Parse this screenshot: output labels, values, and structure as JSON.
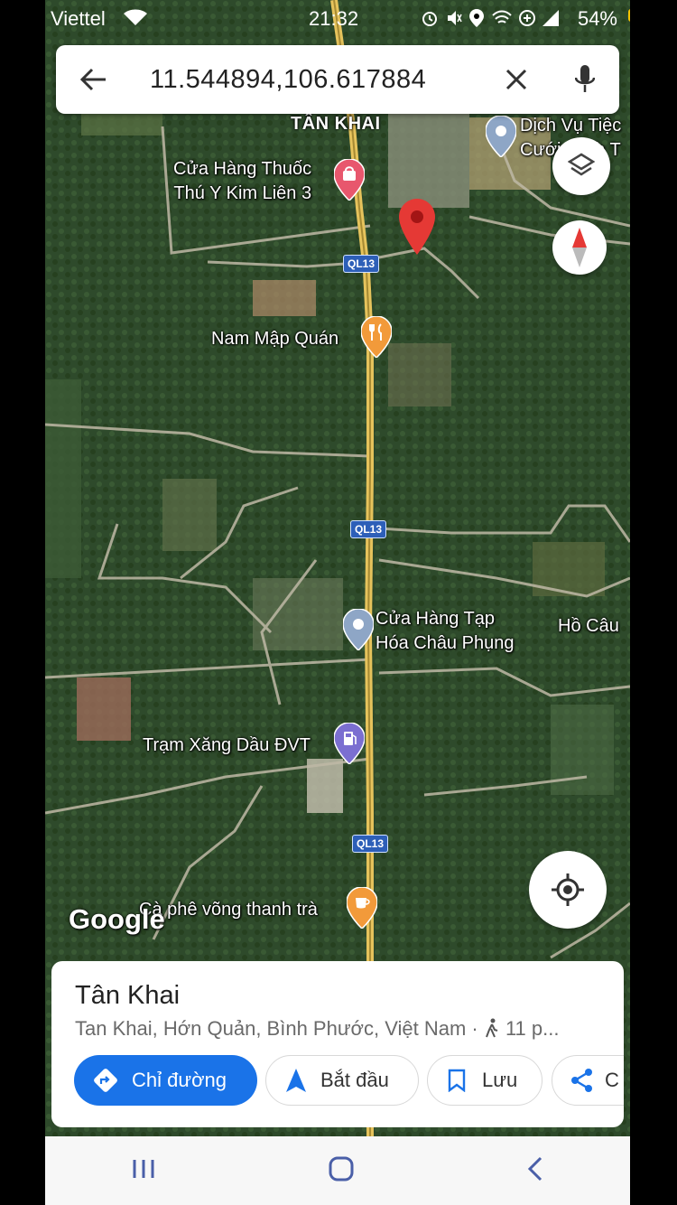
{
  "status_bar": {
    "carrier": "Viettel",
    "time": "21:32",
    "battery": "54%"
  },
  "search": {
    "value": "11.544894,106.617884"
  },
  "map": {
    "place_labels": [
      {
        "text": "TÂN KHAI"
      }
    ],
    "pois": [
      {
        "id": "dich-vu-tiec",
        "text": "Dịch Vụ Tiệc\nCưới Minh T",
        "icon": "map-pin-icon"
      },
      {
        "id": "cua-hang-thuoc",
        "text": "Cửa Hàng Thuốc\nThú Y Kim Liên 3",
        "icon": "shopping-bag-icon"
      },
      {
        "id": "nam-map-quan",
        "text": "Nam Mập Quán",
        "icon": "fork-knife-icon"
      },
      {
        "id": "cua-hang-tap-hoa",
        "text": "Cửa Hàng Tạp\nHóa Châu Phụng",
        "icon": "map-pin-icon"
      },
      {
        "id": "ho-cau",
        "text": "Hồ Câu",
        "icon": ""
      },
      {
        "id": "tram-xang",
        "text": "Trạm Xăng Dầu ĐVT",
        "icon": "gas-station-icon"
      },
      {
        "id": "ca-phe",
        "text": "Cà phê võng thanh trà",
        "icon": "coffee-cup-icon"
      }
    ],
    "route_shields": [
      "QL13",
      "QL13",
      "QL13"
    ],
    "logo": "Google"
  },
  "place_card": {
    "title": "Tân Khai",
    "subtitle": "Tan Khai, Hớn Quản, Bình Phước, Việt Nam · ",
    "walk_time": "11 p...",
    "actions": [
      {
        "label": "Chỉ đường",
        "icon": "directions-icon"
      },
      {
        "label": "Bắt đầu",
        "icon": "navigation-arrow-icon"
      },
      {
        "label": "Lưu",
        "icon": "bookmark-icon"
      },
      {
        "label": "C",
        "icon": "share-icon"
      }
    ]
  },
  "colors": {
    "accent": "#1a73e8",
    "pin": "#e53935",
    "road": "#c9a94a"
  }
}
